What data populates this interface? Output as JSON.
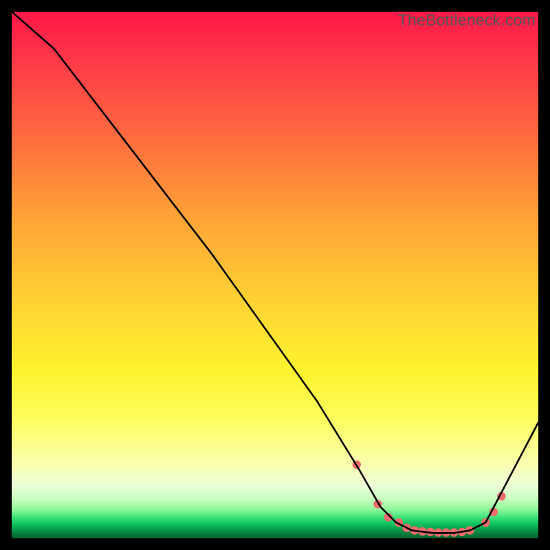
{
  "watermark": "TheBottleneck.com",
  "chart_data": {
    "type": "line",
    "title": "",
    "xlabel": "",
    "ylabel": "",
    "xlim": [
      0,
      100
    ],
    "ylim": [
      0,
      100
    ],
    "grid": false,
    "legend": false,
    "series": [
      {
        "name": "curve",
        "x": [
          0,
          8,
          18,
          28,
          38,
          48,
          58,
          66,
          70,
          73,
          76,
          80,
          84,
          87,
          90,
          100
        ],
        "y": [
          100,
          93,
          80,
          67,
          54,
          40,
          26,
          13,
          6,
          3,
          1.5,
          1,
          1,
          1.5,
          3,
          22
        ],
        "color": "#000000"
      }
    ],
    "markers": {
      "name": "valley-markers",
      "color": "#ef6b6b",
      "x": [
        65.5,
        69.5,
        71.5,
        73.5,
        75,
        76.5,
        78,
        79.5,
        81,
        82.5,
        84,
        85.5,
        87,
        90,
        91.5,
        93
      ],
      "y": [
        14,
        6.5,
        4,
        3,
        2,
        1.5,
        1.3,
        1.2,
        1.1,
        1.1,
        1.1,
        1.2,
        1.5,
        3,
        5,
        8
      ]
    }
  }
}
